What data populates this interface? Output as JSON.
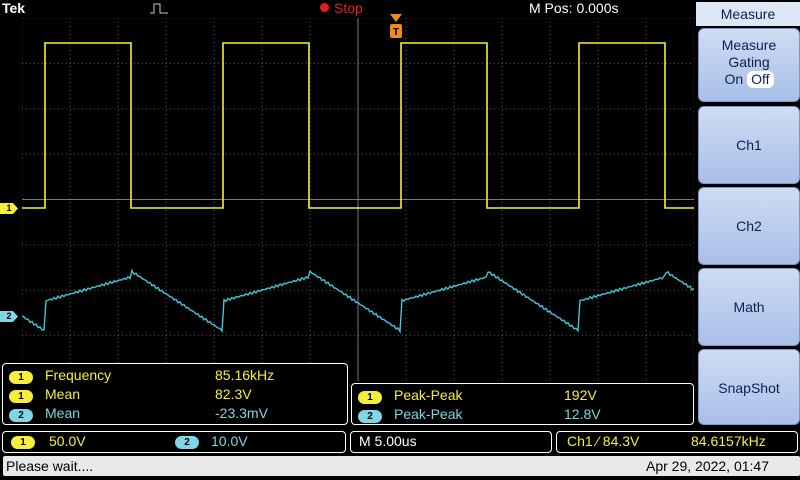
{
  "header": {
    "brand": "Tek",
    "run_state": "Stop",
    "mpos": "M Pos: 0.000s"
  },
  "menu": {
    "title": "Measure",
    "gating_lines": [
      "Measure",
      "Gating"
    ],
    "gating_on": "On",
    "gating_off": "Off",
    "buttons": [
      "Ch1",
      "Ch2",
      "Math",
      "SnapShot"
    ]
  },
  "channels": {
    "ch1": {
      "marker": "1",
      "color": "#f5ef3a"
    },
    "ch2": {
      "marker": "2",
      "color": "#3fc6d9"
    }
  },
  "measurements_left": [
    {
      "ch": "1",
      "name": "Frequency",
      "value": "85.16kHz"
    },
    {
      "ch": "1",
      "name": "Mean",
      "value": "82.3V"
    },
    {
      "ch": "2",
      "name": "Mean",
      "value": "-23.3mV"
    }
  ],
  "measurements_right": [
    {
      "ch": "1",
      "name": "Peak-Peak",
      "value": "192V"
    },
    {
      "ch": "2",
      "name": "Peak-Peak",
      "value": "12.8V"
    }
  ],
  "scale": {
    "ch1": "50.0V",
    "ch2": "10.0V",
    "time": "M 5.00us",
    "trigger": "Ch1 ∕ 84.3V",
    "trigger_freq": "84.6157kHz"
  },
  "status": {
    "message": "Please wait....",
    "datetime": "Apr 29, 2022, 01:47"
  }
}
